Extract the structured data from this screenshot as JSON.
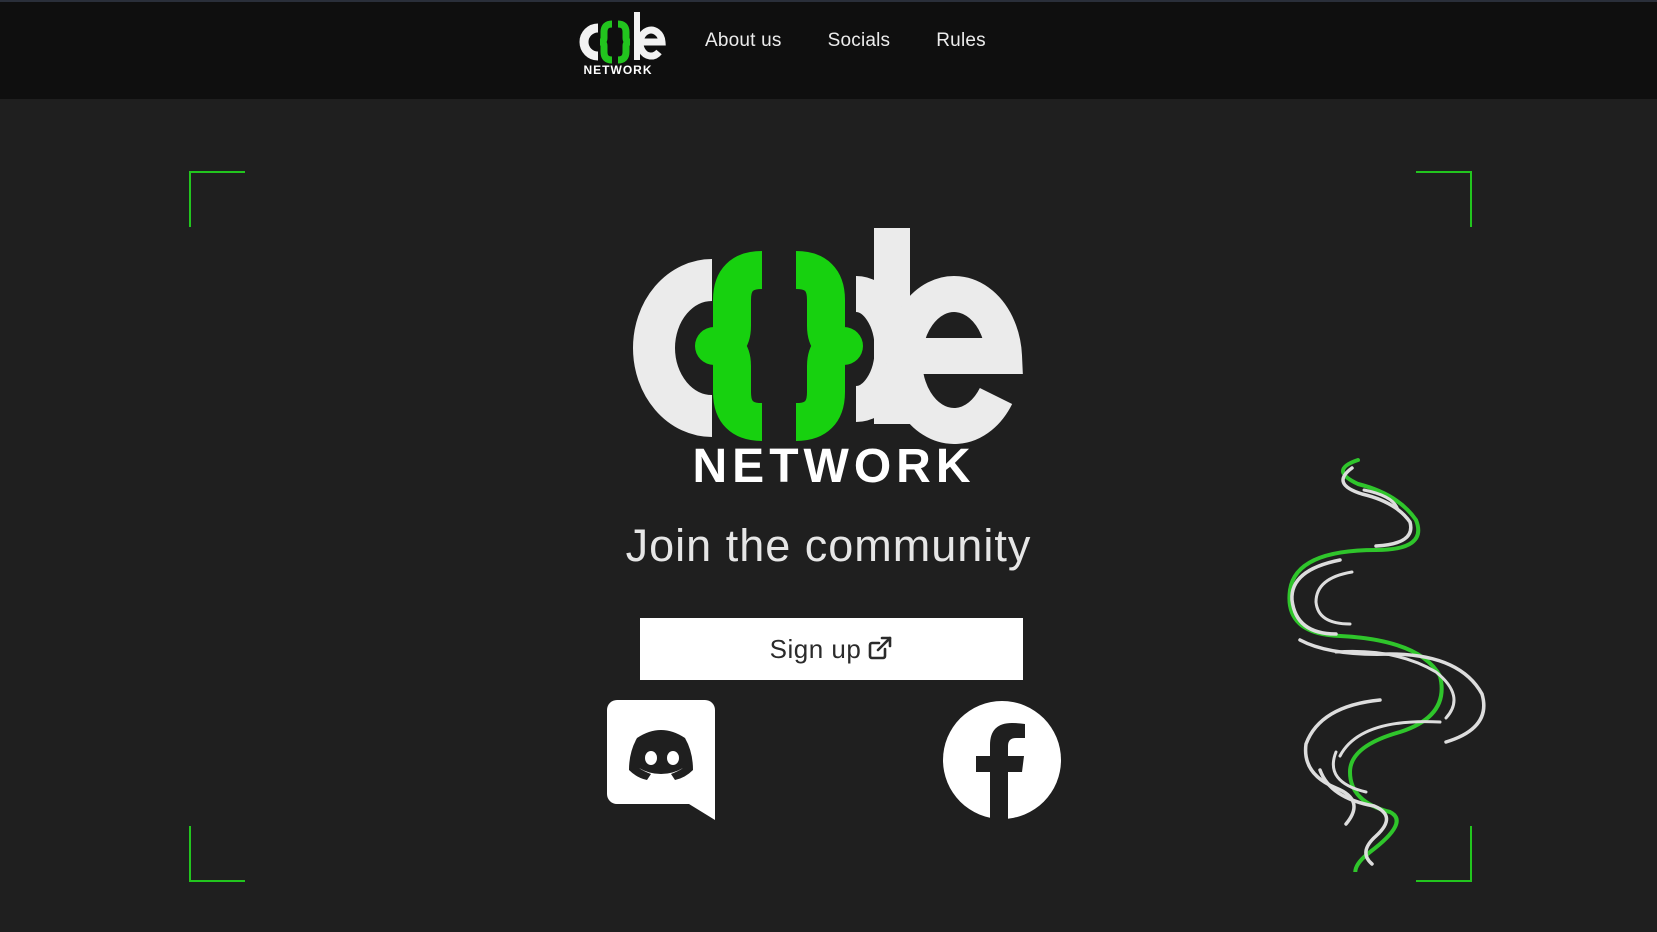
{
  "nav": {
    "logo": {
      "word": "code",
      "sub": "NETWORK"
    },
    "links": [
      {
        "label": "About us"
      },
      {
        "label": "Socials"
      },
      {
        "label": "Rules"
      }
    ]
  },
  "hero": {
    "logo": {
      "word": "code",
      "sub": "NETWORK"
    },
    "tagline": "Join the community",
    "signup": {
      "label": "Sign up",
      "icon": "external-link-icon"
    },
    "socials": [
      {
        "name": "discord",
        "icon": "discord-icon"
      },
      {
        "name": "facebook",
        "icon": "facebook-icon"
      }
    ],
    "decoration": "snake-illustration"
  },
  "colors": {
    "accent": "#22c51e",
    "background": "#1f1f1f",
    "navbar": "#0f0f0f",
    "text": "#e6e6e6"
  }
}
